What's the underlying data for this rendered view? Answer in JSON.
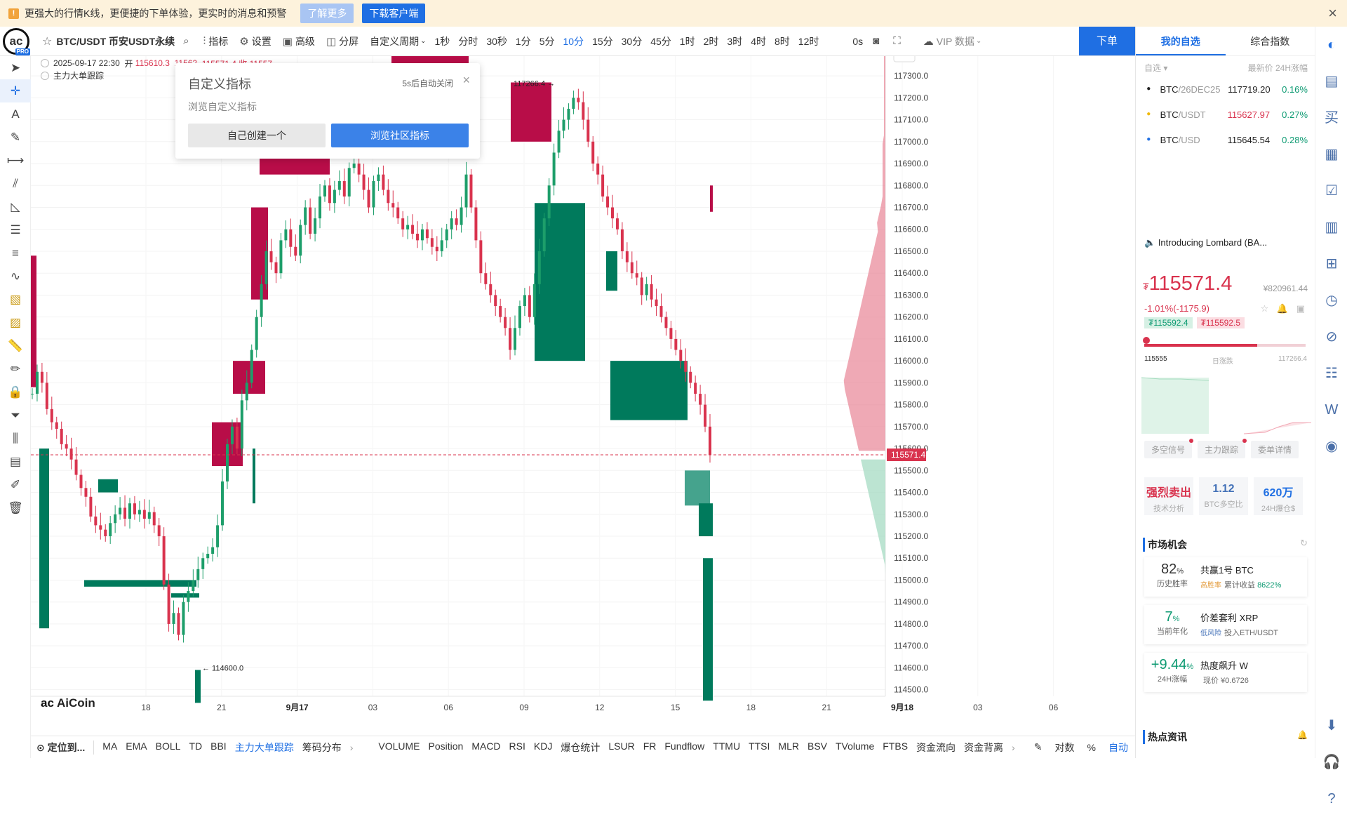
{
  "banner": {
    "message": "更强大的行情K线，更便捷的下单体验，更实时的消息和预警",
    "learn_more": "了解更多",
    "download": "下载客户端"
  },
  "toolbar": {
    "symbol": "BTC/USDT 币安USDT永续",
    "indicators": "指标",
    "settings": "设置",
    "advanced": "高级",
    "split": "分屏",
    "custom_period": "自定义周期",
    "periods": [
      "1秒",
      "分时",
      "30秒",
      "1分",
      "5分",
      "10分",
      "15分",
      "30分",
      "45分",
      "1时",
      "2时",
      "3时",
      "4时",
      "8时",
      "12时"
    ],
    "active_period": "10分",
    "countdown": "0s",
    "vip": "VIP 数据",
    "order": "下单"
  },
  "ohlc": {
    "datetime": "2025-09-17 22:30",
    "open_label": "开",
    "open": "115610.3",
    "high": "11562",
    "rest": "115571.4  收  11557",
    "indicator": "主力大单跟踪"
  },
  "popup": {
    "title": "自定义指标",
    "auto_close": "5s后自动关闭",
    "subtitle": "浏览自定义指标",
    "create": "自己创建一个",
    "browse": "浏览社区指标"
  },
  "chart_data": {
    "type": "candlestick",
    "title": "",
    "y_ticks": [
      "117300.0",
      "117200.0",
      "117100.0",
      "117000.0",
      "116900.0",
      "116800.0",
      "116700.0",
      "116600.0",
      "116500.0",
      "116400.0",
      "116300.0",
      "116200.0",
      "116100.0",
      "116000.0",
      "115900.0",
      "115800.0",
      "115700.0",
      "115600.0",
      "115500.0",
      "115400.0",
      "115300.0",
      "115200.0",
      "115100.0",
      "115000.0",
      "114900.0",
      "114800.0",
      "114700.0",
      "114600.0",
      "114500.0"
    ],
    "ylim": [
      114470,
      117390
    ],
    "x_ticks": [
      "18",
      "21",
      "9月17",
      "03",
      "06",
      "09",
      "12",
      "15",
      "18",
      "21",
      "9月18",
      "03",
      "06"
    ],
    "high_marker": "117266.4",
    "low_marker": "114600.0",
    "last_price": "115571.4",
    "last_price_value": 115571.4,
    "close_series": [
      115850,
      115950,
      115900,
      115780,
      115720,
      115690,
      115620,
      115600,
      115550,
      115480,
      115420,
      115380,
      115290,
      115250,
      115230,
      115200,
      115260,
      115300,
      115330,
      115280,
      115350,
      115300,
      115320,
      115280,
      115310,
      115250,
      115200,
      114980,
      114800,
      114850,
      114750,
      114900,
      114950,
      115000,
      115050,
      115100,
      115120,
      115150,
      115250,
      115450,
      115620,
      115700,
      115600,
      115820,
      115900,
      116050,
      116200,
      116350,
      116500,
      116450,
      116400,
      116550,
      116600,
      116520,
      116480,
      116620,
      116700,
      116580,
      116650,
      116750,
      116800,
      116720,
      116780,
      116820,
      116750,
      116880,
      116900,
      116850,
      116780,
      116700,
      116820,
      116850,
      116780,
      116720,
      116700,
      116650,
      116600,
      116620,
      116580,
      116550,
      116600,
      116560,
      116520,
      116500,
      116550,
      116600,
      116650,
      116620,
      116700,
      116850,
      116700,
      116550,
      116400,
      116350,
      116300,
      116250,
      116200,
      116150,
      116050,
      116150,
      116250,
      116300,
      116200,
      116350,
      116500,
      116650,
      116800,
      116950,
      117050,
      117100,
      117150,
      117200,
      117180,
      117100,
      117000,
      116900,
      116850,
      116750,
      116700,
      116650,
      116600,
      116500,
      116450,
      116400,
      116380,
      116300,
      116350,
      116280,
      116250,
      116200,
      116150,
      116100,
      116050,
      116000,
      115950,
      115900,
      115850,
      115800,
      115700,
      115571
    ]
  },
  "bottombar": {
    "locate": "定位到...",
    "main_items": [
      "MA",
      "EMA",
      "BOLL",
      "TD",
      "BBI",
      "主力大单跟踪",
      "筹码分布"
    ],
    "active_main": "主力大单跟踪",
    "sub_items": [
      "VOLUME",
      "Position",
      "MACD",
      "RSI",
      "KDJ",
      "爆仓统计",
      "LSUR",
      "FR",
      "Fundflow",
      "TTMU",
      "TTSI",
      "MLR",
      "BSV",
      "TVolume",
      "FTBS",
      "资金流向",
      "资金背离"
    ],
    "log": "对数",
    "percent": "%",
    "auto": "自动"
  },
  "watermark": "AiCoin",
  "right": {
    "tabs": [
      "我的自选",
      "综合指数"
    ],
    "header_left": "自选",
    "header_right": "最新价  24H涨幅",
    "watchlist": [
      {
        "base": "BTC",
        "quote": "/26DEC25",
        "price": "117719.20",
        "change": "0.16%",
        "price_color": "dark"
      },
      {
        "base": "BTC",
        "quote": "/USDT",
        "price": "115627.97",
        "change": "0.27%",
        "price_color": "red"
      },
      {
        "base": "BTC",
        "quote": "/USD",
        "price": "115645.54",
        "change": "0.28%",
        "price_color": "dark"
      }
    ],
    "news": "Introducing Lombard (BA...",
    "price_symbol": "₮",
    "price": "115571.4",
    "cny": "¥820961.44",
    "change": "-1.01%(-1175.9)",
    "bid": "₮115592.4",
    "ask": "₮115592.5",
    "range_low": "115555",
    "range_mid": "日涨跌",
    "range_high": "117266.4",
    "range_fraction": 0.7,
    "subtabs": [
      "多空信号",
      "主力跟踪",
      "委单详情"
    ],
    "stats": [
      {
        "value": "强烈卖出",
        "label": "技术分析"
      },
      {
        "value": "1.12",
        "label": "BTC多空比"
      },
      {
        "value": "620万",
        "label": "24H爆仓$"
      }
    ],
    "market_title": "市场机会",
    "opportunities": [
      {
        "big": "82",
        "unit": "%",
        "small": "历史胜率",
        "title": "共赢1号 BTC",
        "tag": "高胜率",
        "desc": "累计收益",
        "value": "8622%"
      },
      {
        "big": "7",
        "unit": "%",
        "small": "当前年化",
        "title": "价差套利 XRP",
        "tag": "低风险",
        "desc": "投入ETH/USDT",
        "value": ""
      },
      {
        "big": "+9.44",
        "unit": "%",
        "small": "24H涨幅",
        "title": "热度飙升 W",
        "tag": "",
        "desc": "现价 ¥0.6726",
        "value": ""
      }
    ],
    "hot_title": "热点资讯"
  }
}
